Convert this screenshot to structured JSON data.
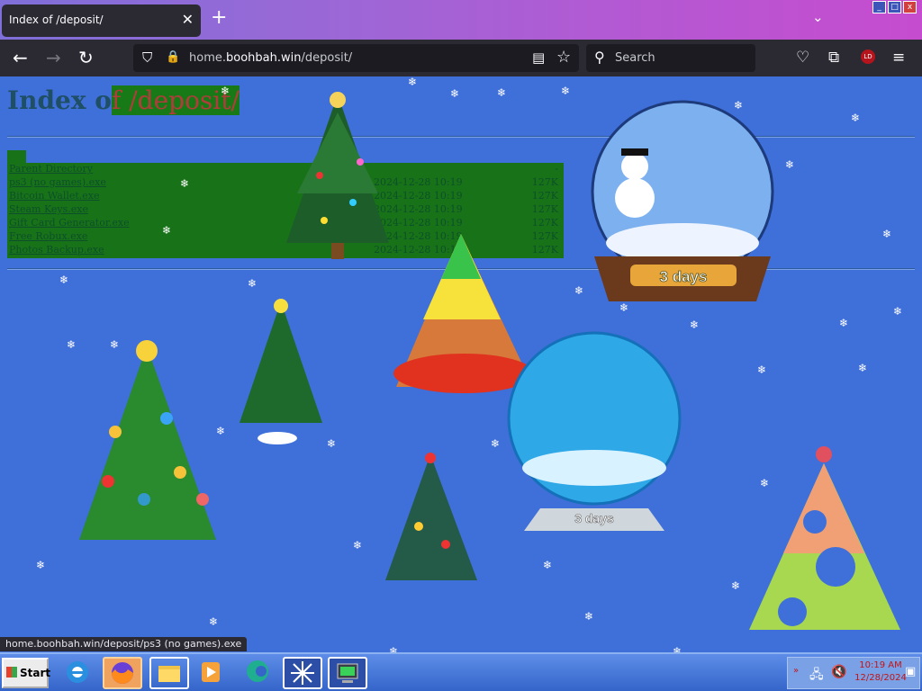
{
  "browser": {
    "tab_title": "Index of /deposit/",
    "tab_close": "✕",
    "new_tab": "+",
    "url_host": "home.",
    "url_domain": "boohbah.win",
    "url_path": "/deposit/",
    "search_placeholder": "Search",
    "extension_badge": "LD"
  },
  "page": {
    "title_prefix": "Index o",
    "title_highlight": "f /deposit/",
    "listing": [
      {
        "name": "Parent Directory",
        "date": "",
        "size": "-"
      },
      {
        "name": "ps3 (no games).exe",
        "date": "2024-12-28 10:19",
        "size": "127K"
      },
      {
        "name": "Bitcoin Wallet.exe",
        "date": "2024-12-28 10:19",
        "size": "127K"
      },
      {
        "name": "Steam Keys.exe",
        "date": "2024-12-28 10:19",
        "size": "127K"
      },
      {
        "name": "Gift Card Generator.exe",
        "date": "2024-12-28 10:19",
        "size": "127K"
      },
      {
        "name": "Free Robux.exe",
        "date": "2024-12-28 10:19",
        "size": "127K"
      },
      {
        "name": "Photos Backup.exe",
        "date": "2024-12-28 10:19",
        "size": "127K"
      }
    ],
    "globe1_label": "3 days",
    "globe2_label": "3 days"
  },
  "status_url": "home.boohbah.win/deposit/ps3 (no games).exe",
  "taskbar": {
    "start_label": "Start",
    "clock_time": "10:19 AM",
    "clock_date": "12/28/2024"
  },
  "colors": {
    "page_bg": "#3f6fd8",
    "listing_bg": "#187318",
    "title_color": "#1f4f64",
    "highlight_text": "#b23c3c"
  }
}
